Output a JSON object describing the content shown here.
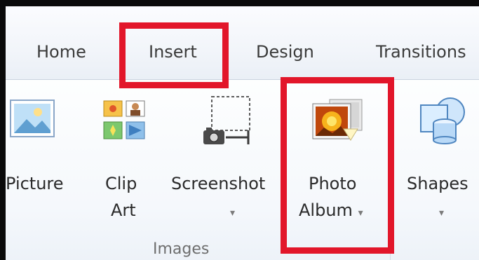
{
  "tabs": [
    {
      "label": "Home"
    },
    {
      "label": "Insert"
    },
    {
      "label": "Design"
    },
    {
      "label": "Transitions"
    }
  ],
  "commands": {
    "picture": {
      "label": "Picture"
    },
    "clip_art": {
      "label_line1": "Clip",
      "label_line2": "Art"
    },
    "screenshot": {
      "label": "Screenshot",
      "arrow": "▾"
    },
    "photo_album": {
      "label_line1": "Photo",
      "label_line2": "Album",
      "arrow": "▾"
    },
    "shapes": {
      "label": "Shapes",
      "arrow": "▾"
    }
  },
  "group": {
    "label": "Images"
  },
  "colors": {
    "highlight": "#e2162a",
    "accent_blue": "#3b4bf0"
  },
  "icons": [
    "picture-icon",
    "clip-art-icon",
    "screenshot-icon",
    "photo-album-icon",
    "shapes-icon"
  ]
}
